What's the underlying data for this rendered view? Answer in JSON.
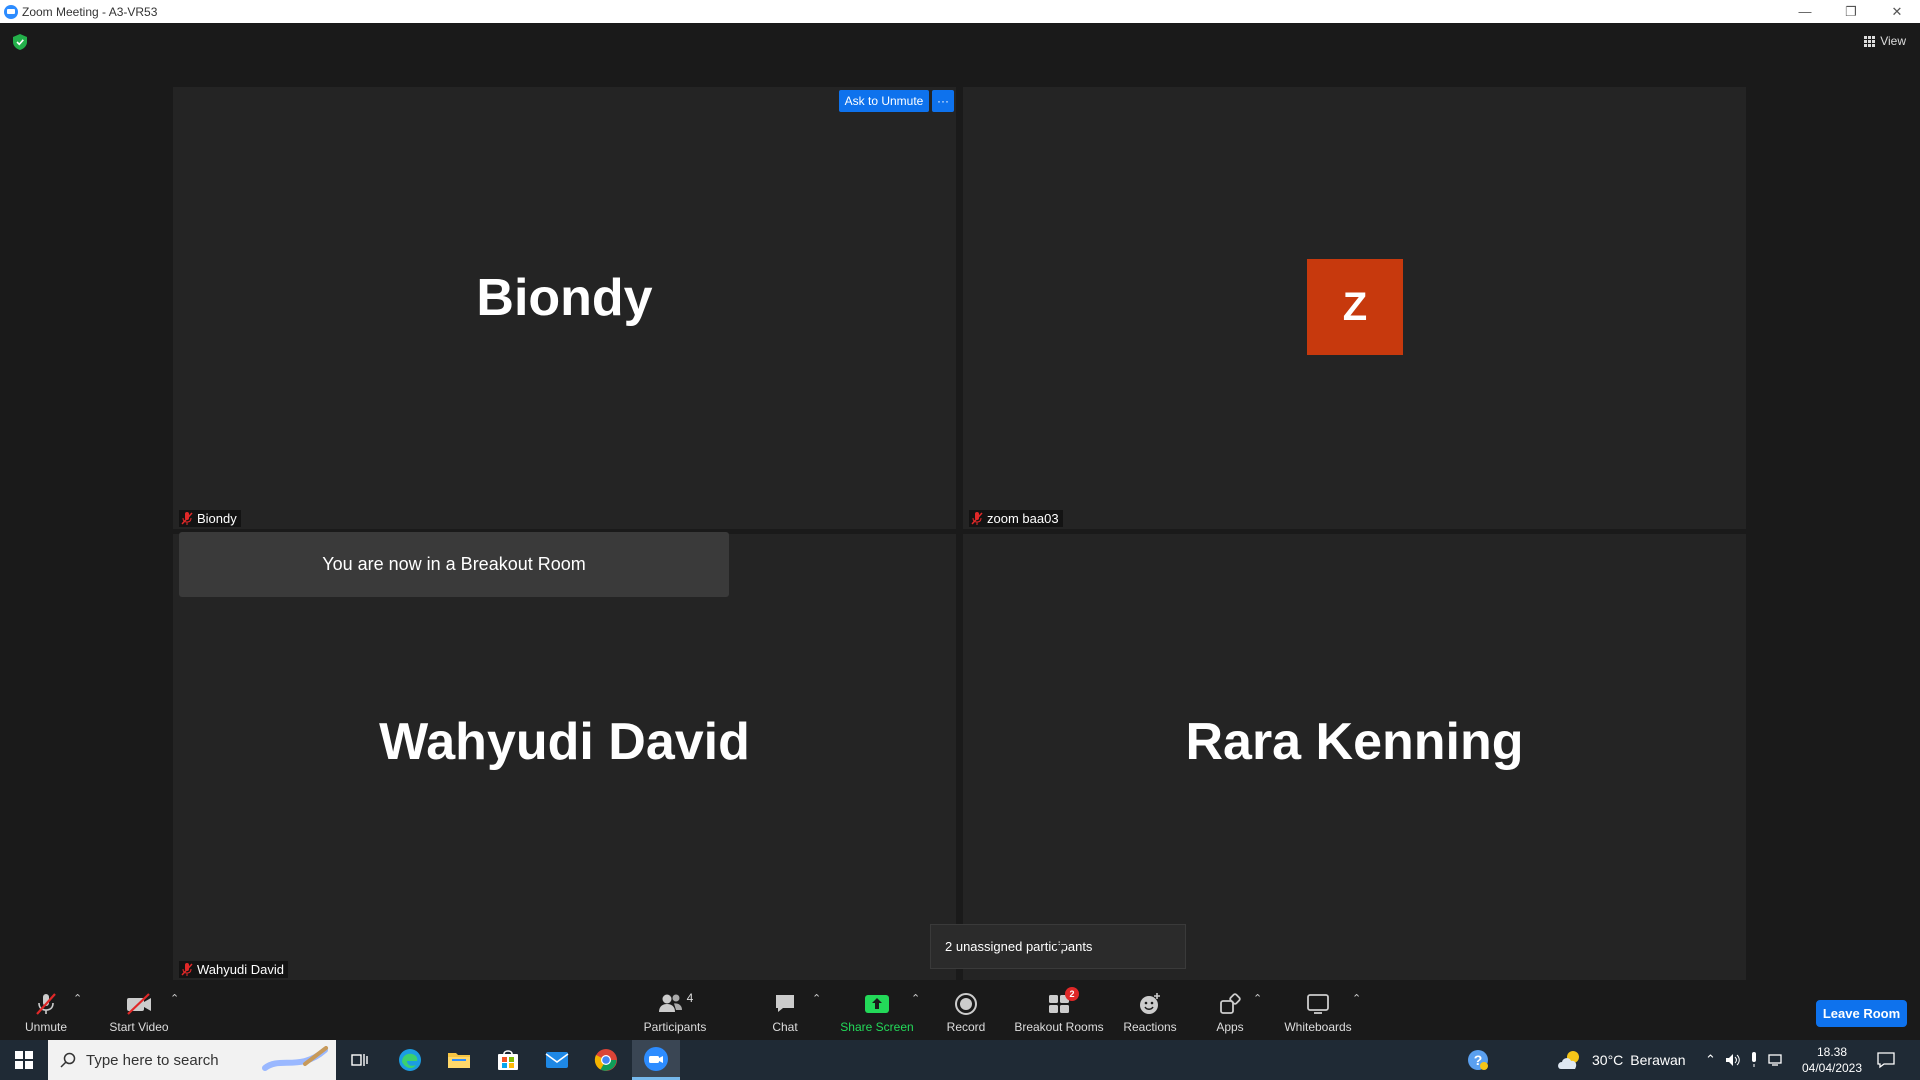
{
  "window": {
    "title": "Zoom Meeting - A3-VR53",
    "controls": [
      "—",
      "❐",
      "✕"
    ]
  },
  "header": {
    "view_label": "View"
  },
  "tiles": [
    {
      "name": "Biondy",
      "label": "Biondy"
    },
    {
      "name": "zoom baa03",
      "label": "zoom baa03",
      "avatar_letter": "Z",
      "avatar_color": "#c7390d"
    },
    {
      "name": "Wahyudi David",
      "label": "Wahyudi David"
    },
    {
      "name": "Rara Kenning",
      "label": ""
    }
  ],
  "tile_actions": {
    "ask_to_unmute": "Ask to Unmute",
    "more": "···"
  },
  "notifications": {
    "breakout_room": "You are now in a Breakout Room",
    "unassigned": "2 unassigned participants"
  },
  "toolbar": {
    "unmute": "Unmute",
    "start_video": "Start Video",
    "participants": "Participants",
    "participants_count": "4",
    "chat": "Chat",
    "share_screen": "Share Screen",
    "record": "Record",
    "breakout_rooms": "Breakout Rooms",
    "breakout_badge": "2",
    "reactions": "Reactions",
    "apps": "Apps",
    "whiteboards": "Whiteboards",
    "leave_room": "Leave Room",
    "share_color": "#23d959"
  },
  "taskbar": {
    "search_placeholder": "Type here to search",
    "weather_temp": "30°C",
    "weather_desc": "Berawan",
    "time": "18.38",
    "date": "04/04/2023"
  }
}
